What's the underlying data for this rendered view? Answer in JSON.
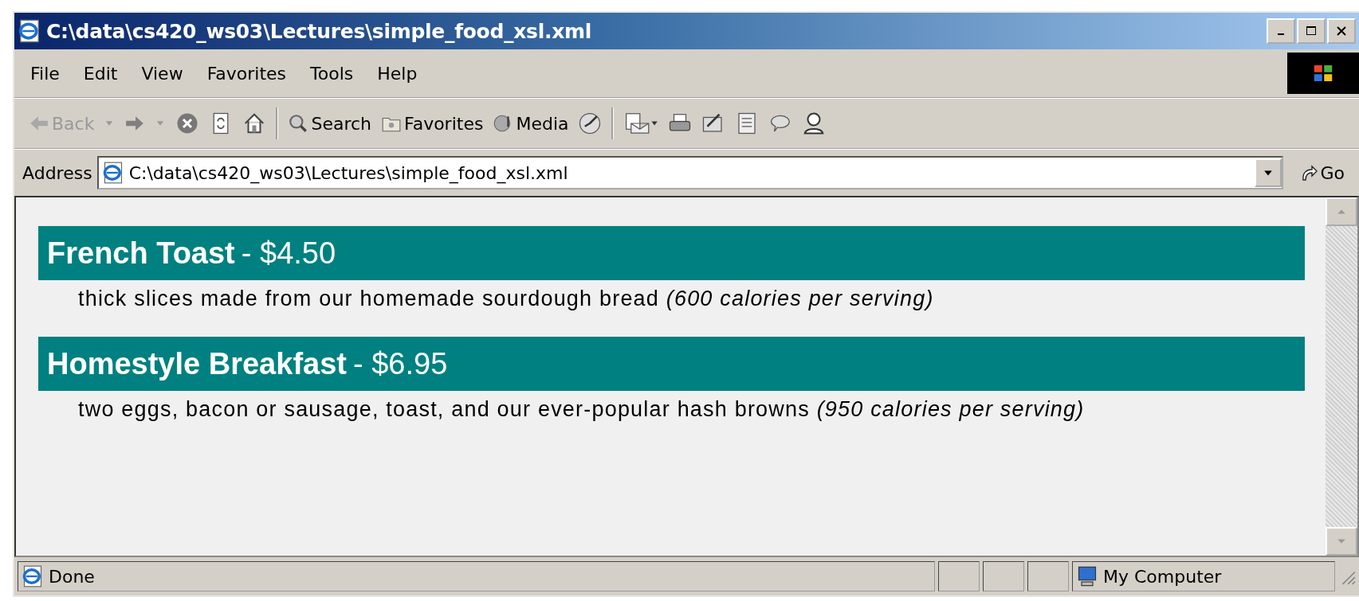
{
  "window": {
    "title": "C:\\data\\cs420_ws03\\Lectures\\simple_food_xsl.xml"
  },
  "menu": [
    "File",
    "Edit",
    "View",
    "Favorites",
    "Tools",
    "Help"
  ],
  "toolbar": {
    "back": {
      "label": "Back",
      "disabled": true
    },
    "forward": {
      "disabled": false
    },
    "search": "Search",
    "favorites": "Favorites",
    "media": "Media"
  },
  "address": {
    "label": "Address",
    "value": "C:\\data\\cs420_ws03\\Lectures\\simple_food_xsl.xml",
    "go": "Go"
  },
  "menu_items": [
    {
      "name": "French Toast",
      "price": "- $4.50",
      "description": "thick slices made from our homemade sourdough bread",
      "calories": "(600 calories per serving)"
    },
    {
      "name": "Homestyle Breakfast",
      "price": "- $6.95",
      "description": "two eggs, bacon or sausage, toast, and our ever-popular hash browns",
      "calories": "(950 calories per serving)"
    }
  ],
  "status_bar": {
    "text": "Done",
    "zone": "My Computer"
  }
}
